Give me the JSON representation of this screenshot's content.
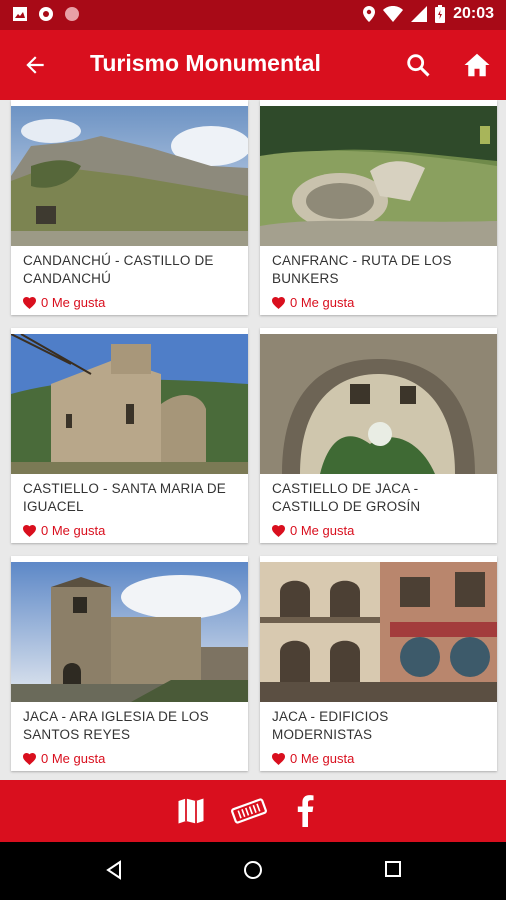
{
  "status_bar": {
    "time": "20:03"
  },
  "app_bar": {
    "title": "Turismo Monumental"
  },
  "cards": [
    {
      "name": "CANDANCHÚ - CASTILLO DE CANDANCHÚ",
      "likes": "0 Me gusta"
    },
    {
      "name": "CANFRANC - RUTA DE LOS BUNKERS",
      "likes": "0 Me gusta"
    },
    {
      "name": "CASTIELLO - SANTA MARIA DE IGUACEL",
      "likes": "0 Me gusta"
    },
    {
      "name": "CASTIELLO DE JACA - CASTILLO DE GROSÍN",
      "likes": "0 Me gusta"
    },
    {
      "name": "JACA - ARA IGLESIA DE LOS SANTOS REYES",
      "likes": "0 Me gusta"
    },
    {
      "name": "JACA - EDIFICIOS MODERNISTAS",
      "likes": "0 Me gusta"
    }
  ],
  "bottom_bar": {
    "icons": [
      "map-icon",
      "ticket-icon",
      "facebook-icon"
    ]
  },
  "colors": {
    "primary": "#d90f1e",
    "status": "#a80a17",
    "like": "#d90f1e"
  }
}
